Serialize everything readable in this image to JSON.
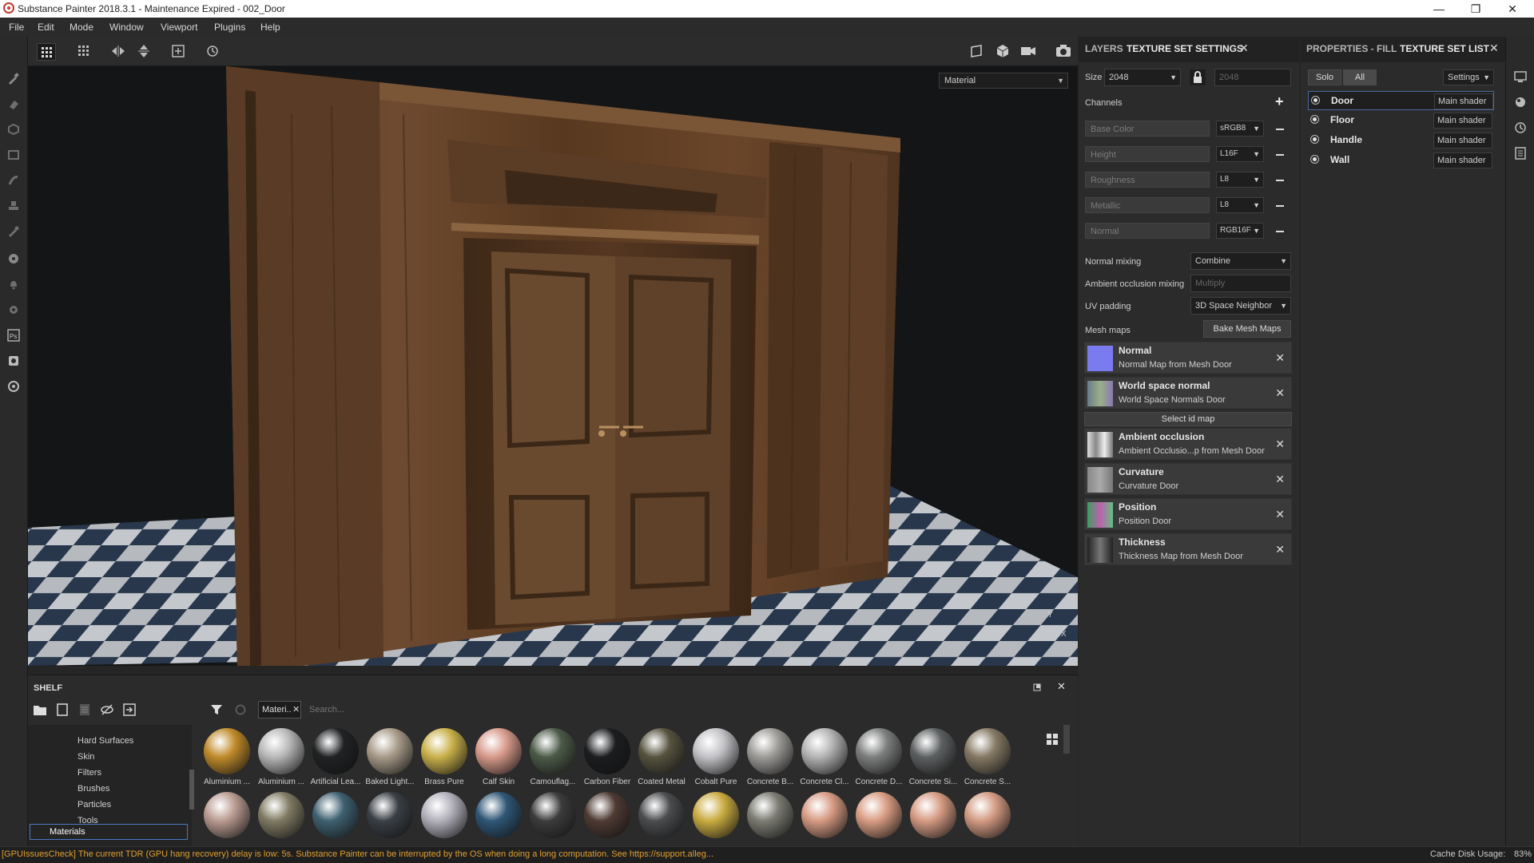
{
  "window": {
    "title": "Substance Painter 2018.3.1 - Maintenance Expired - 002_Door",
    "minimize": "—",
    "maximize": "❐",
    "close": "✕"
  },
  "menu": [
    "File",
    "Edit",
    "Mode",
    "Window",
    "Viewport",
    "Plugins",
    "Help"
  ],
  "viewport": {
    "mode_select": "Material",
    "axis_y": "Y",
    "axis_x": "Z X"
  },
  "texture_settings": {
    "tabs": [
      "LAYERS",
      "TEXTURE SET SETTINGS"
    ],
    "size_label": "Size",
    "size_value": "2048",
    "size_locked_value": "2048",
    "channels_label": "Channels",
    "channels": [
      {
        "name": "Base Color",
        "format": "sRGB8"
      },
      {
        "name": "Height",
        "format": "L16F"
      },
      {
        "name": "Roughness",
        "format": "L8"
      },
      {
        "name": "Metallic",
        "format": "L8"
      },
      {
        "name": "Normal",
        "format": "RGB16F"
      }
    ],
    "normal_mixing_label": "Normal mixing",
    "normal_mixing_value": "Combine",
    "ao_mixing_label": "Ambient occlusion mixing",
    "ao_mixing_value": "Multiply",
    "uv_padding_label": "UV padding",
    "uv_padding_value": "3D Space Neighbor",
    "mesh_maps_label": "Mesh maps",
    "bake_button": "Bake Mesh Maps",
    "select_id_map": "Select id map",
    "mesh_maps": [
      {
        "name": "Normal",
        "sub": "Normal Map from Mesh Door"
      },
      {
        "name": "World space normal",
        "sub": "World Space Normals Door"
      },
      {
        "name": "Ambient occlusion",
        "sub": "Ambient Occlusio...p from Mesh Door"
      },
      {
        "name": "Curvature",
        "sub": "Curvature Door"
      },
      {
        "name": "Position",
        "sub": "Position Door"
      },
      {
        "name": "Thickness",
        "sub": "Thickness Map from Mesh Door"
      }
    ]
  },
  "texture_set_list": {
    "tabs": [
      "PROPERTIES - FILL",
      "TEXTURE SET LIST"
    ],
    "solo": "Solo",
    "all": "All",
    "settings": "Settings",
    "sets": [
      {
        "name": "Door",
        "shader": "Main shader"
      },
      {
        "name": "Floor",
        "shader": "Main shader"
      },
      {
        "name": "Handle",
        "shader": "Main shader"
      },
      {
        "name": "Wall",
        "shader": "Main shader"
      }
    ]
  },
  "shelf": {
    "title": "SHELF",
    "filter_chip": "Materi..",
    "search_placeholder": "Search...",
    "categories": [
      "Hard Surfaces",
      "Skin",
      "Filters",
      "Brushes",
      "Particles",
      "Tools",
      "Materials"
    ],
    "selected_category": "Materials",
    "materials_row1": [
      {
        "label": "Aluminium ...",
        "color": "#c08a2a"
      },
      {
        "label": "Aluminium ...",
        "color": "#b8b8b8"
      },
      {
        "label": "Artificial Lea...",
        "color": "#202224"
      },
      {
        "label": "Baked Light...",
        "color": "#a79a88"
      },
      {
        "label": "Brass Pure",
        "color": "#c9b04a"
      },
      {
        "label": "Calf Skin",
        "color": "#d7998a"
      },
      {
        "label": "Camouflag...",
        "color": "#4c5a48"
      },
      {
        "label": "Carbon Fiber",
        "color": "#1b1d1f"
      },
      {
        "label": "Coated Metal",
        "color": "#56533f"
      },
      {
        "label": "Cobalt Pure",
        "color": "#c2c2c6"
      },
      {
        "label": "Concrete B...",
        "color": "#9d9b98"
      },
      {
        "label": "Concrete Cl...",
        "color": "#b3b3b3"
      },
      {
        "label": "Concrete D...",
        "color": "#7c7e7d"
      },
      {
        "label": "Concrete Si...",
        "color": "#5d6061"
      },
      {
        "label": "Concrete S...",
        "color": "#857964"
      }
    ],
    "materials_row2": [
      {
        "color": "#b89a90"
      },
      {
        "color": "#7f7a62"
      },
      {
        "color": "#3e6070"
      },
      {
        "color": "#3a3f45"
      },
      {
        "color": "#b2b0bb"
      },
      {
        "color": "#2e5676"
      },
      {
        "color": "#3c3c3c"
      },
      {
        "color": "#4e3a33"
      },
      {
        "color": "#4a4c4e"
      },
      {
        "color": "#c9ab40"
      },
      {
        "color": "#7b7b72"
      },
      {
        "color": "#d69a82"
      },
      {
        "color": "#d89c82"
      },
      {
        "color": "#d59a82"
      },
      {
        "color": "#d39a82"
      }
    ]
  },
  "status": {
    "message": "[GPUIssuesCheck] The current TDR (GPU hang recovery) delay is low: 5s. Substance Painter can be interrupted by the OS when doing a long computation. See https://support.alleg...",
    "cache_label": "Cache Disk Usage:",
    "cache_value": "83%"
  }
}
